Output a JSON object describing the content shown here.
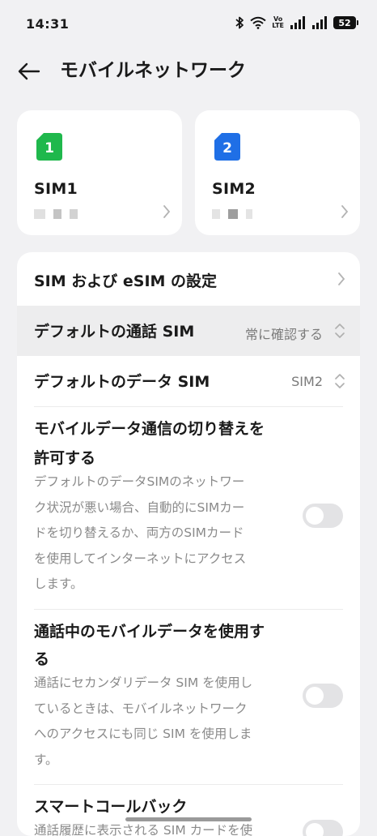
{
  "status_bar": {
    "time": "14:31",
    "volte": "Vo\nLTE",
    "battery": "52"
  },
  "header": {
    "title": "モバイルネットワーク"
  },
  "sim_cards": [
    {
      "name": "SIM1",
      "slot": "1",
      "color": "#1fb84c"
    },
    {
      "name": "SIM2",
      "slot": "2",
      "color": "#1f6fe6"
    }
  ],
  "settings": {
    "sim_esim": {
      "title": "SIM および eSIM の設定"
    },
    "default_call": {
      "title": "デフォルトの通話 SIM",
      "value": "常に確認する"
    },
    "default_data": {
      "title": "デフォルトのデータ SIM",
      "value": "SIM2"
    },
    "data_switch": {
      "title_line1": "モバイルデータ通信の切り替えを",
      "title_line2": "許可する",
      "desc_lines": [
        "デフォルトのデータSIMのネットワー",
        "ク状況が悪い場合、自動的にSIMカー",
        "ドを切り替えるか、両方のSIMカード",
        "を使用してインターネットにアクセス",
        "します。"
      ],
      "enabled": false
    },
    "data_during_call": {
      "title_line1": "通話中のモバイルデータを使用す",
      "title_line2": "る",
      "desc_lines": [
        "通話にセカンダリデータ SIM を使用し",
        "ているときは、モバイルネットワーク",
        "へのアクセスにも同じ SIM を使用しま",
        "す。"
      ],
      "enabled": false
    },
    "smart_callback": {
      "title": "スマートコールバック",
      "desc_partial": "通話履歴に表示される SIM カードを使"
    }
  }
}
